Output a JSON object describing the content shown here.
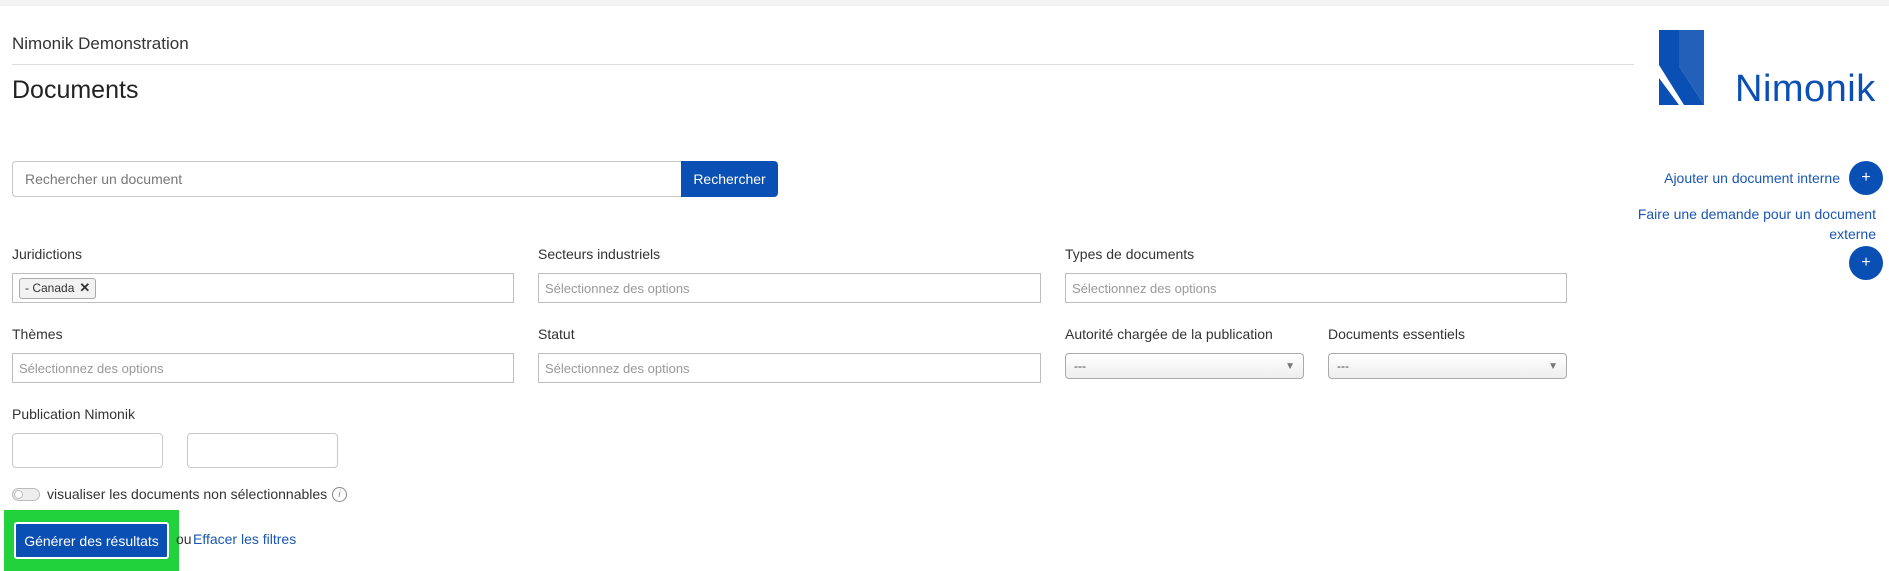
{
  "header": {
    "org_name": "Nimonik Demonstration",
    "page_title": "Documents"
  },
  "logo": {
    "word": "Nimonik"
  },
  "search": {
    "placeholder": "Rechercher un document",
    "button_label": "Rechercher"
  },
  "sidebar": {
    "add_internal_label": "Ajouter un document interne",
    "request_external_label": "Faire une demande pour un document externe",
    "plus_symbol": "+"
  },
  "filters": {
    "jurisdictions": {
      "label": "Juridictions",
      "tags": [
        "- Canada"
      ]
    },
    "sectors": {
      "label": "Secteurs industriels",
      "placeholder": "Sélectionnez des options"
    },
    "doc_types": {
      "label": "Types de documents",
      "placeholder": "Sélectionnez des options"
    },
    "themes": {
      "label": "Thèmes",
      "placeholder": "Sélectionnez des options"
    },
    "status": {
      "label": "Statut",
      "placeholder": "Sélectionnez des options"
    },
    "authority": {
      "label": "Autorité chargée de la publication",
      "value": "---"
    },
    "essential": {
      "label": "Documents essentiels",
      "value": "---"
    },
    "publication": {
      "label": "Publication Nimonik"
    }
  },
  "toggle": {
    "label": "visualiser les documents non sélectionnables",
    "on": false
  },
  "actions": {
    "generate_label": "Générer des résultats",
    "or_text": "ou",
    "clear_label": "Effacer les filtres"
  },
  "colors": {
    "primary": "#0a4fb3",
    "highlight": "#22d23c",
    "link": "#1a56b3"
  },
  "icons": {
    "tag_remove": "✕",
    "select_arrow": "▼",
    "info": "i"
  }
}
